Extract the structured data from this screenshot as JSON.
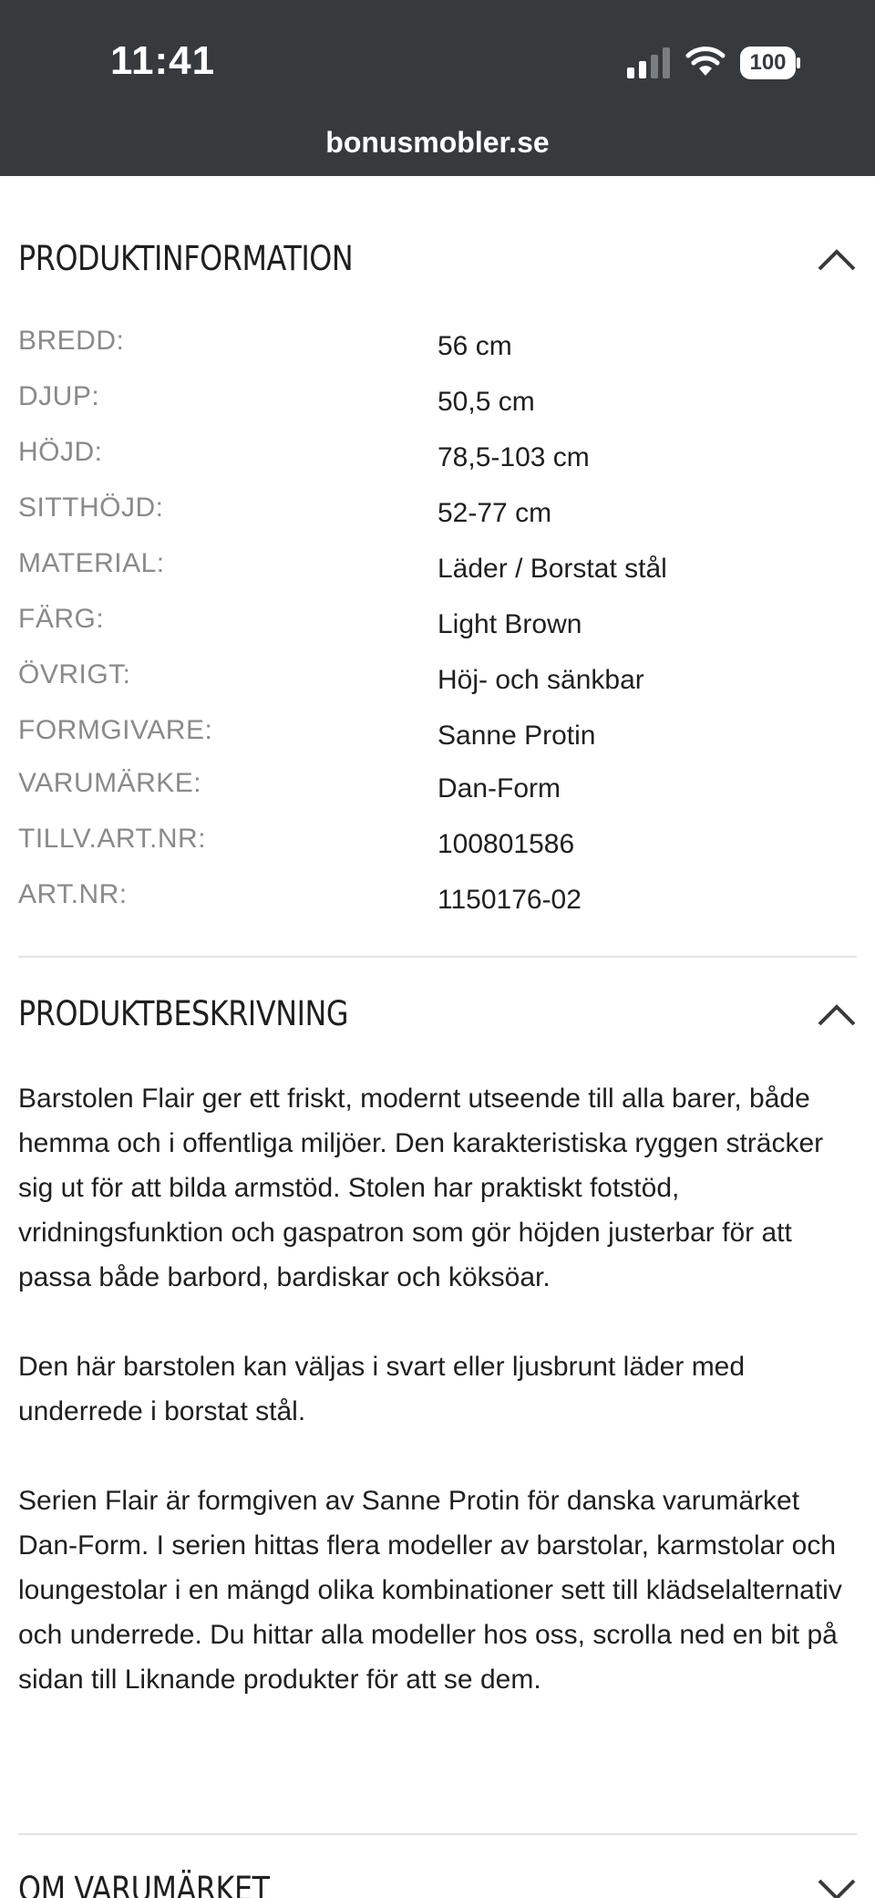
{
  "status_bar": {
    "time": "11:41",
    "battery": "100"
  },
  "browser": {
    "url": "bonusmobler.se"
  },
  "produktinformation": {
    "title": "PRODUKTINFORMATION",
    "rows": [
      {
        "label": "BREDD:",
        "value": "56 cm"
      },
      {
        "label": "DJUP:",
        "value": "50,5 cm"
      },
      {
        "label": "HÖJD:",
        "value": "78,5-103 cm"
      },
      {
        "label": "SITTHÖJD:",
        "value": "52-77 cm"
      },
      {
        "label": "MATERIAL:",
        "value": "Läder / Borstat stål"
      },
      {
        "label": "FÄRG:",
        "value": "Light Brown"
      },
      {
        "label": "ÖVRIGT:",
        "value": "Höj- och sänkbar"
      },
      {
        "label": "FORMGIVARE:",
        "value": "Sanne Protin"
      },
      {
        "label": "VARUMÄRKE:",
        "value": "Dan-Form"
      },
      {
        "label": "TILLV.ART.NR:",
        "value": "100801586"
      },
      {
        "label": "ART.NR:",
        "value": "1150176-02"
      }
    ]
  },
  "produktbeskrivning": {
    "title": "PRODUKTBESKRIVNING",
    "paragraphs": [
      "Barstolen Flair ger ett friskt, modernt utseende till alla barer, både hemma och i offentliga miljöer. Den karakteristiska ryggen sträcker sig ut för att bilda armstöd. Stolen har praktiskt fotstöd, vridningsfunktion och gaspatron som gör höjden justerbar för att passa både barbord, bardiskar och köksöar.",
      "Den här barstolen kan väljas i svart eller ljusbrunt läder med underrede i borstat stål.",
      "Serien Flair är formgiven av Sanne Protin för danska varumärket Dan-Form. I serien hittas flera modeller av barstolar, karmstolar och loungestolar i en mängd olika kombinationer sett till klädselalternativ och underrede. Du hittar alla modeller hos oss, scrolla ned en bit på sidan till Liknande produkter för att se dem."
    ]
  },
  "om_varumarket": {
    "title": "OM VARUMÄRKET"
  }
}
